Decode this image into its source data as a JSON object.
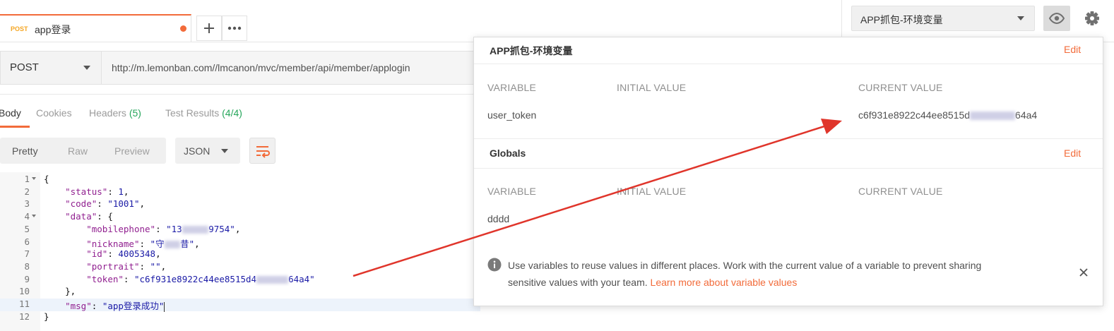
{
  "tab": {
    "method": "POST",
    "name": "app登录"
  },
  "request": {
    "method": "POST",
    "url": "http://m.lemonban.com//lmcanon/mvc/member/api/member/applogin"
  },
  "response_tabs": [
    {
      "label": "Body"
    },
    {
      "label": "Cookies"
    },
    {
      "label": "Headers",
      "count": "(5)"
    },
    {
      "label": "Test Results",
      "count": "(4/4)"
    }
  ],
  "view_modes": [
    "Pretty",
    "Raw",
    "Preview"
  ],
  "format": "JSON",
  "code_lines": [
    {
      "n": "1",
      "fold": true,
      "parts": [
        [
          "p",
          "{"
        ]
      ]
    },
    {
      "n": "2",
      "parts": [
        [
          "p",
          "    "
        ],
        [
          "k",
          "\"status\""
        ],
        [
          "p",
          ": "
        ],
        [
          "v",
          "1"
        ],
        [
          "p",
          ","
        ]
      ]
    },
    {
      "n": "3",
      "parts": [
        [
          "p",
          "    "
        ],
        [
          "k",
          "\"code\""
        ],
        [
          "p",
          ": "
        ],
        [
          "s",
          "\"1001\""
        ],
        [
          "p",
          ","
        ]
      ]
    },
    {
      "n": "4",
      "fold": true,
      "parts": [
        [
          "p",
          "    "
        ],
        [
          "k",
          "\"data\""
        ],
        [
          "p",
          ": {"
        ]
      ]
    },
    {
      "n": "5",
      "parts": [
        [
          "p",
          "        "
        ],
        [
          "k",
          "\"mobilephone\""
        ],
        [
          "p",
          ": "
        ],
        [
          "s",
          "\"13"
        ],
        [
          "b",
          "XXXXX"
        ],
        [
          "s",
          "9754\""
        ],
        [
          "p",
          ","
        ]
      ]
    },
    {
      "n": "6",
      "parts": [
        [
          "p",
          "        "
        ],
        [
          "k",
          "\"nickname\""
        ],
        [
          "p",
          ": "
        ],
        [
          "s",
          "\"守"
        ],
        [
          "b",
          "XXX"
        ],
        [
          "s",
          "昔\""
        ],
        [
          "p",
          ","
        ]
      ]
    },
    {
      "n": "7",
      "parts": [
        [
          "p",
          "        "
        ],
        [
          "k",
          "\"id\""
        ],
        [
          "p",
          ": "
        ],
        [
          "v",
          "4005348"
        ],
        [
          "p",
          ","
        ]
      ]
    },
    {
      "n": "8",
      "parts": [
        [
          "p",
          "        "
        ],
        [
          "k",
          "\"portrait\""
        ],
        [
          "p",
          ": "
        ],
        [
          "s",
          "\"\""
        ],
        [
          "p",
          ","
        ]
      ]
    },
    {
      "n": "9",
      "parts": [
        [
          "p",
          "        "
        ],
        [
          "k",
          "\"token\""
        ],
        [
          "p",
          ": "
        ],
        [
          "s",
          "\"c6f931e8922c44ee8515d4"
        ],
        [
          "b",
          "XXXXXX"
        ],
        [
          "s",
          "64a4\""
        ]
      ]
    },
    {
      "n": "10",
      "parts": [
        [
          "p",
          "    },"
        ]
      ]
    },
    {
      "n": "11",
      "highlight": true,
      "parts": [
        [
          "p",
          "    "
        ],
        [
          "k",
          "\"msg\""
        ],
        [
          "p",
          ": "
        ],
        [
          "s",
          "\"app登录成功\""
        ],
        [
          "c",
          ""
        ]
      ]
    },
    {
      "n": "12",
      "parts": [
        [
          "p",
          "}"
        ]
      ]
    }
  ],
  "environment": {
    "selected": "APP抓包-环境变量",
    "section_title": "APP抓包-环境变量",
    "edit_label": "Edit",
    "columns": [
      "VARIABLE",
      "INITIAL VALUE",
      "CURRENT VALUE"
    ],
    "rows": [
      {
        "variable": "user_token",
        "initial": "",
        "current_prefix": "c6f931e8922c44ee8515d",
        "current_suffix": "64a4"
      }
    ]
  },
  "globals": {
    "section_title": "Globals",
    "edit_label": "Edit",
    "columns": [
      "VARIABLE",
      "INITIAL VALUE",
      "CURRENT VALUE"
    ],
    "rows": [
      {
        "variable": "dddd",
        "initial": "",
        "current": ""
      }
    ]
  },
  "info": {
    "text_1": "Use variables to reuse values in different places. Work with the current value of a variable to prevent sharing",
    "text_2": "sensitive values with your team.",
    "link": "Learn more about variable values"
  },
  "colors": {
    "accent": "#f26b3a",
    "annotation_arrow": "#e0352b",
    "count_green": "#26a65b"
  },
  "icons": [
    "plus-icon",
    "more-icon",
    "chevron-down-icon",
    "wrap-icon",
    "eye-icon",
    "gear-icon",
    "info-icon",
    "close-icon"
  ]
}
